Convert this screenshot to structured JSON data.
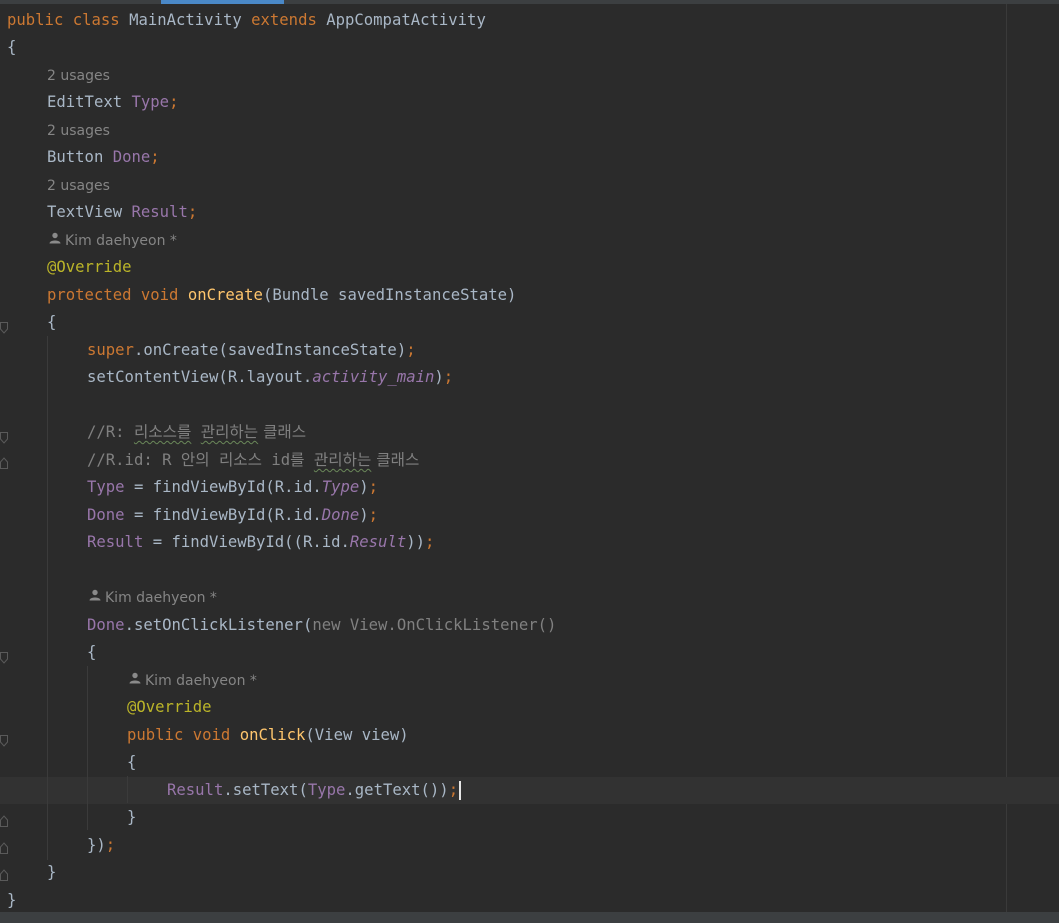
{
  "editor": {
    "code": {
      "l1": [
        "public",
        " ",
        "class",
        " MainActivity ",
        "extends",
        " AppCompatActivity"
      ],
      "l2": [
        "{"
      ],
      "l3": [
        "EditText ",
        "Type",
        ";"
      ],
      "l4": [
        "Button ",
        "Done",
        ";"
      ],
      "l5": [
        "TextView ",
        "Result",
        ";"
      ],
      "l6": [
        "@Override"
      ],
      "l7": [
        "protected",
        " ",
        "void",
        " ",
        "onCreate",
        "(Bundle savedInstanceState)"
      ],
      "l8": [
        "{"
      ],
      "l9": [
        "super",
        ".onCreate(savedInstanceState)",
        ";"
      ],
      "l10": [
        "setContentView(R.layout.",
        "activity_main",
        ")",
        ";"
      ],
      "l11": [
        "//R: ",
        "리소스를",
        " ",
        "관리하는",
        " 클래스"
      ],
      "l12": [
        "//R.id: R 안의 리소스 id를 ",
        "관리하는",
        " 클래스"
      ],
      "l13": [
        "Type",
        " = findViewById(R.id.",
        "Type",
        ")",
        ";"
      ],
      "l14": [
        "Done",
        " = findViewById(R.id.",
        "Done",
        ")",
        ";"
      ],
      "l15": [
        "Result",
        " = findViewById((R.id.",
        "Result",
        "))",
        ";"
      ],
      "l16": [
        "Done",
        ".setOnClickListener(",
        "new View.OnClickListener()"
      ],
      "l17": [
        "{"
      ],
      "l18": [
        "@Override"
      ],
      "l19": [
        "public",
        " ",
        "void",
        " ",
        "onClick",
        "(View view)"
      ],
      "l20": [
        "{"
      ],
      "l21": [
        "Result",
        ".setText(",
        "Type",
        ".getText())",
        ";"
      ],
      "l22": [
        "}"
      ],
      "l23": [
        "})",
        ";"
      ],
      "l24": [
        "}"
      ],
      "l25": [
        "}"
      ]
    },
    "hints": {
      "usages": "2 usages",
      "author": "Kim daehyeon *"
    },
    "icons": {
      "author": "person-icon",
      "fold": "fold-marker-icon"
    }
  }
}
